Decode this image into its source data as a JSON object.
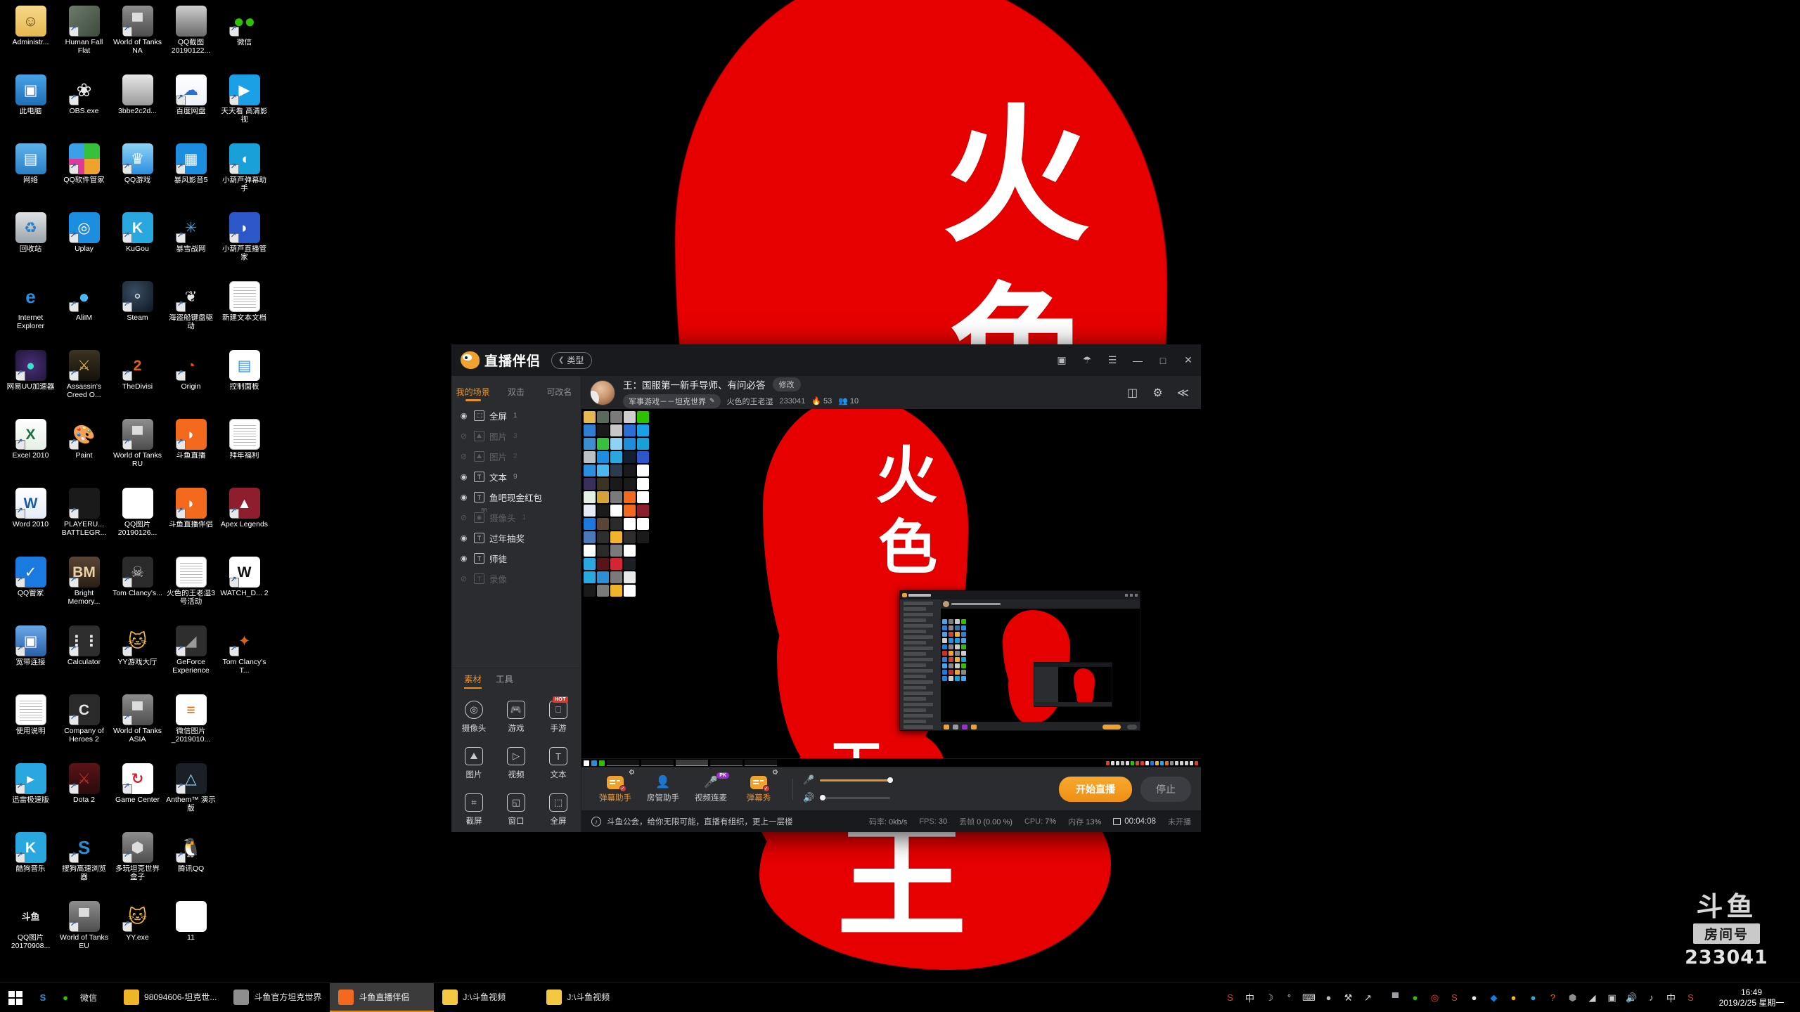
{
  "desktop": {
    "icons": [
      {
        "label": "Administr...",
        "type": "folder-user",
        "shortcut": false
      },
      {
        "label": "Human Fall Flat",
        "type": "thumb-gray",
        "shortcut": true
      },
      {
        "label": "World of Tanks NA",
        "type": "wot",
        "shortcut": true
      },
      {
        "label": "QQ截图 20190122...",
        "type": "thumb-photo",
        "shortcut": false
      },
      {
        "label": "微信",
        "type": "wechat",
        "shortcut": true
      },
      {
        "label": "此电脑",
        "type": "pc",
        "shortcut": false
      },
      {
        "label": "OBS.exe",
        "type": "obs",
        "shortcut": true
      },
      {
        "label": "3bbe2c2d...",
        "type": "thumb-shot",
        "shortcut": false
      },
      {
        "label": "百度网盘",
        "type": "baidu",
        "shortcut": true
      },
      {
        "label": "天天看 高清影视",
        "type": "tiantian",
        "shortcut": true
      },
      {
        "label": "网络",
        "type": "network",
        "shortcut": false
      },
      {
        "label": "QQ软件管家",
        "type": "qqmgr",
        "shortcut": true
      },
      {
        "label": "QQ游戏",
        "type": "qqgame",
        "shortcut": true
      },
      {
        "label": "暴风影音5",
        "type": "baofeng",
        "shortcut": true
      },
      {
        "label": "小葫芦弹幕助手",
        "type": "huluwa",
        "shortcut": true
      },
      {
        "label": "回收站",
        "type": "recycle",
        "shortcut": false
      },
      {
        "label": "Uplay",
        "type": "uplay",
        "shortcut": true
      },
      {
        "label": "KuGou",
        "type": "kugou",
        "shortcut": true
      },
      {
        "label": "暴雪战网",
        "type": "battlenet",
        "shortcut": true
      },
      {
        "label": "小葫芦直播管家",
        "type": "huluwa2",
        "shortcut": true
      },
      {
        "label": "Internet Explorer",
        "type": "ie",
        "shortcut": false
      },
      {
        "label": "AliIM",
        "type": "aliim",
        "shortcut": true
      },
      {
        "label": "Steam",
        "type": "steam",
        "shortcut": true
      },
      {
        "label": "海盗船键盘驱动",
        "type": "corsair",
        "shortcut": true
      },
      {
        "label": "新建文本文档",
        "type": "doc",
        "shortcut": false
      },
      {
        "label": "网易UU加速器",
        "type": "uu",
        "shortcut": true
      },
      {
        "label": "Assassin's Creed O...",
        "type": "acod",
        "shortcut": true
      },
      {
        "label": "TheDivisi",
        "type": "division2",
        "shortcut": true
      },
      {
        "label": "Origin",
        "type": "origin",
        "shortcut": true
      },
      {
        "label": "控制面板",
        "type": "ctrlpanel",
        "shortcut": false
      },
      {
        "label": "Excel 2010",
        "type": "excel",
        "shortcut": true
      },
      {
        "label": "Paint",
        "type": "paint",
        "shortcut": true
      },
      {
        "label": "World of Tanks RU",
        "type": "wot",
        "shortcut": true
      },
      {
        "label": "斗鱼直播",
        "type": "douyu",
        "shortcut": true
      },
      {
        "label": "拜年福利",
        "type": "doc",
        "shortcut": false
      },
      {
        "label": "Word 2010",
        "type": "word",
        "shortcut": true
      },
      {
        "label": "PLAYERU... BATTLEGR...",
        "type": "pubg",
        "shortcut": true
      },
      {
        "label": "QQ图片 20190126...",
        "type": "thumb-white",
        "shortcut": false
      },
      {
        "label": "斗鱼直播伴侣",
        "type": "douyu2",
        "shortcut": true
      },
      {
        "label": "Apex Legends",
        "type": "apex",
        "shortcut": true
      },
      {
        "label": "QQ管家",
        "type": "qqguard",
        "shortcut": true
      },
      {
        "label": "Bright Memory...",
        "type": "brightmem",
        "shortcut": true
      },
      {
        "label": "Tom Clancy's...",
        "type": "ghost",
        "shortcut": true
      },
      {
        "label": "火色的王老湿3号活动",
        "type": "doc",
        "shortcut": false
      },
      {
        "label": "WATCH_D... 2",
        "type": "watchdogs",
        "shortcut": true
      },
      {
        "label": "宽带连接",
        "type": "broadband",
        "shortcut": true
      },
      {
        "label": "Calculator",
        "type": "calc",
        "shortcut": true
      },
      {
        "label": "YY游戏大厅",
        "type": "yy",
        "shortcut": true
      },
      {
        "label": "GeForce Experience",
        "type": "geforce",
        "shortcut": true
      },
      {
        "label": "Tom Clancy's T...",
        "type": "division",
        "shortcut": true
      },
      {
        "label": "使用说明",
        "type": "doc",
        "shortcut": false
      },
      {
        "label": "Company of Heroes 2",
        "type": "coh2",
        "shortcut": true
      },
      {
        "label": "World of Tanks ASIA",
        "type": "wot",
        "shortcut": true
      },
      {
        "label": "微信图片 _2019010...",
        "type": "thumb-list",
        "shortcut": false
      },
      {
        "label": "",
        "type": "none",
        "shortcut": false
      },
      {
        "label": "迅雷极速版",
        "type": "xunlei",
        "shortcut": true
      },
      {
        "label": "Dota 2",
        "type": "dota",
        "shortcut": true
      },
      {
        "label": "Game Center",
        "type": "gamecenter",
        "shortcut": true
      },
      {
        "label": "Anthem™ 演示版",
        "type": "anthem",
        "shortcut": true
      },
      {
        "label": "",
        "type": "none",
        "shortcut": false
      },
      {
        "label": "酷狗音乐",
        "type": "kugou",
        "shortcut": true
      },
      {
        "label": "搜狗高速浏览器",
        "type": "sogou",
        "shortcut": true
      },
      {
        "label": "多玩坦克世界盒子",
        "type": "duowan",
        "shortcut": true
      },
      {
        "label": "腾讯QQ",
        "type": "qq",
        "shortcut": true
      },
      {
        "label": "",
        "type": "none",
        "shortcut": false
      },
      {
        "label": "QQ图片 20170908...",
        "type": "douyu-logo",
        "shortcut": false
      },
      {
        "label": "World of Tanks EU",
        "type": "wot",
        "shortcut": true
      },
      {
        "label": "YY.exe",
        "type": "yy",
        "shortcut": true
      },
      {
        "label": "11",
        "type": "thumb-white",
        "shortcut": false
      },
      {
        "label": "",
        "type": "none",
        "shortcut": false
      }
    ],
    "watermark": {
      "logo": "斗鱼",
      "room_label": "房间号",
      "room_number": "233041"
    },
    "wallpaper_chars": [
      "火",
      "色",
      "王"
    ]
  },
  "taskbar": {
    "start_icon": "windows-logo",
    "quick_launch": [
      {
        "name": "sogou-browser-icon",
        "glyph": "S",
        "color": "#2c8fd6"
      },
      {
        "name": "wechat-icon",
        "glyph": "●",
        "color": "#2dc100"
      }
    ],
    "quick_label": "微信",
    "items": [
      {
        "label": "98094606-坦克世...",
        "icon": "yy-icon",
        "color": "#f0b429",
        "active": false
      },
      {
        "label": "斗鱼官方坦克世界",
        "icon": "wot-icon",
        "color": "#8e8e8e",
        "active": false
      },
      {
        "label": "斗鱼直播伴侣",
        "icon": "douyu-icon",
        "color": "#f36a1e",
        "active": true
      },
      {
        "label": "J:\\斗鱼视频",
        "icon": "folder-icon",
        "color": "#f5c842",
        "active": false
      },
      {
        "label": "J:\\斗鱼视频",
        "icon": "folder-icon",
        "color": "#f5c842",
        "active": false
      }
    ],
    "tray_left": [
      {
        "name": "sogou-ime-icon",
        "glyph": "S",
        "color": "#e23b2e"
      },
      {
        "name": "ime-chinese-icon",
        "glyph": "中",
        "color": "#dcdcdc"
      },
      {
        "name": "moon-icon",
        "glyph": "☽",
        "color": "#dcdcdc"
      },
      {
        "name": "degree-icon",
        "glyph": "°",
        "color": "#dcdcdc"
      },
      {
        "name": "keyboard-icon",
        "glyph": "⌨",
        "color": "#dcdcdc"
      },
      {
        "name": "user-icon",
        "glyph": "●",
        "color": "#bbb"
      },
      {
        "name": "wrench-icon",
        "glyph": "⚒",
        "color": "#dcdcdc"
      },
      {
        "name": "expand-icon",
        "glyph": "↗",
        "color": "#dcdcdc"
      }
    ],
    "tray_right": [
      {
        "name": "wot-tray-icon",
        "glyph": "▀",
        "color": "#9aa0a6"
      },
      {
        "name": "wechat-tray-icon",
        "glyph": "●",
        "color": "#2dc100"
      },
      {
        "name": "uu-tray-icon",
        "glyph": "◎",
        "color": "#d94a3a"
      },
      {
        "name": "sogou-tray-icon",
        "glyph": "S",
        "color": "#e23b2e"
      },
      {
        "name": "qq-tray-icon",
        "glyph": "●",
        "color": "#e8e8e8"
      },
      {
        "name": "qqguard-tray-icon",
        "glyph": "◆",
        "color": "#1b7ae0"
      },
      {
        "name": "yy-tray-icon",
        "glyph": "●",
        "color": "#f0b429"
      },
      {
        "name": "baofeng-tray-icon",
        "glyph": "●",
        "color": "#29a8e0"
      },
      {
        "name": "douyu-tray-icon",
        "glyph": "?",
        "color": "#f36a1e"
      },
      {
        "name": "wot-box-tray-icon",
        "glyph": "⬢",
        "color": "#8e8e8e"
      },
      {
        "name": "network-tray-icon",
        "glyph": "◢",
        "color": "#cfcfcf"
      },
      {
        "name": "display-tray-icon",
        "glyph": "▣",
        "color": "#cfcfcf"
      },
      {
        "name": "volume-tray-icon",
        "glyph": "🔊",
        "color": "#cfcfcf"
      },
      {
        "name": "action-tray-icon",
        "glyph": "♪",
        "color": "#cfcfcf"
      },
      {
        "name": "ime-mode-icon",
        "glyph": "中",
        "color": "#dcdcdc"
      },
      {
        "name": "sogou-pinyin-icon",
        "glyph": "S",
        "color": "#e23b2e"
      }
    ],
    "clock_time": "16:49",
    "clock_date": "2019/2/25 星期一"
  },
  "app": {
    "title": "直播伴侣",
    "category_button": "类型",
    "window_controls": [
      {
        "name": "monitor-icon",
        "glyph": "▣"
      },
      {
        "name": "shirt-icon",
        "glyph": "☂"
      },
      {
        "name": "menu-icon",
        "glyph": "☰"
      },
      {
        "name": "minimize-icon",
        "glyph": "—"
      },
      {
        "name": "maximize-icon",
        "glyph": "□"
      },
      {
        "name": "close-icon",
        "glyph": "✕"
      }
    ],
    "scene_tabs": [
      {
        "label": "我的场景",
        "active": true
      },
      {
        "label": "双击",
        "active": false
      },
      {
        "label": "可改名",
        "active": false
      }
    ],
    "scenes": [
      {
        "icon": "fullscreen-icon",
        "glyph": "⬚",
        "name": "全屏",
        "num": "1",
        "visible": true
      },
      {
        "icon": "image-icon",
        "glyph": "⛰",
        "name": "图片",
        "num": "3",
        "visible": false
      },
      {
        "icon": "image-icon",
        "glyph": "⛰",
        "name": "图片",
        "num": "2",
        "visible": false
      },
      {
        "icon": "text-icon",
        "glyph": "T",
        "name": "文本",
        "num": "9",
        "visible": true
      },
      {
        "icon": "text-icon",
        "glyph": "T",
        "name": "鱼吧现金红包",
        "num": "",
        "visible": true
      },
      {
        "icon": "camera-icon",
        "glyph": "◉",
        "name": "摄像头",
        "num": "1",
        "visible": false
      },
      {
        "icon": "text-icon",
        "glyph": "T",
        "name": "过年抽奖",
        "num": "",
        "visible": true
      },
      {
        "icon": "text-icon",
        "glyph": "T",
        "name": "师徒",
        "num": "",
        "visible": true
      },
      {
        "icon": "text-icon",
        "glyph": "T",
        "name": "录像",
        "num": "",
        "visible": false
      }
    ],
    "source_tabs": [
      {
        "label": "素材",
        "active": true
      },
      {
        "label": "工具",
        "active": false
      }
    ],
    "sources": [
      {
        "label": "摄像头",
        "icon": "camera-icon",
        "glyph": "◎",
        "round": true,
        "badge": ""
      },
      {
        "label": "游戏",
        "icon": "gamepad-icon",
        "glyph": "🎮",
        "round": false,
        "badge": ""
      },
      {
        "label": "手游",
        "icon": "mobile-game-icon",
        "glyph": "⎕",
        "round": false,
        "badge": "HOT"
      },
      {
        "label": "图片",
        "icon": "image-icon",
        "glyph": "⛰",
        "round": false,
        "badge": ""
      },
      {
        "label": "视频",
        "icon": "video-icon",
        "glyph": "▷",
        "round": false,
        "badge": ""
      },
      {
        "label": "文本",
        "icon": "text-icon",
        "glyph": "T",
        "round": false,
        "badge": ""
      },
      {
        "label": "截屏",
        "icon": "crop-icon",
        "glyph": "⌗",
        "round": false,
        "badge": ""
      },
      {
        "label": "窗口",
        "icon": "window-icon",
        "glyph": "◱",
        "round": false,
        "badge": ""
      },
      {
        "label": "全屏",
        "icon": "fullscreen-icon",
        "glyph": "⬚",
        "round": false,
        "badge": ""
      }
    ],
    "user": {
      "stream_title": "王：国服第一新手导师、有问必答",
      "edit_button": "修改",
      "category": "军事游戏－－坦克世界",
      "nickname": "火色的王老湿",
      "room_id": "233041",
      "hot_count": "53",
      "viewer_count": "10"
    },
    "header_icons": [
      {
        "name": "layout-icon",
        "glyph": "◫"
      },
      {
        "name": "settings-gear-icon",
        "glyph": "⚙"
      },
      {
        "name": "share-icon",
        "glyph": "≪"
      }
    ],
    "controls": [
      {
        "label": "弹幕助手",
        "name": "danmaku-assistant",
        "type": "chip",
        "active": true,
        "gear": true,
        "check": true,
        "badge": ""
      },
      {
        "label": "房管助手",
        "name": "room-admin-assistant",
        "type": "person",
        "active": false,
        "gear": false,
        "check": false,
        "badge": ""
      },
      {
        "label": "视频连麦",
        "name": "video-link-mic",
        "type": "mic",
        "active": false,
        "gear": false,
        "check": false,
        "badge": "PK"
      },
      {
        "label": "弹幕秀",
        "name": "danmaku-show",
        "type": "chip",
        "active": true,
        "gear": true,
        "check": true,
        "badge": ""
      }
    ],
    "mic_volume_pct": 100,
    "speaker_volume_pct": 4,
    "go_live_button": "开始直播",
    "stop_button": "停止",
    "status": {
      "notice": "斗鱼公会，给你无限可能，直播有组织，更上一层楼",
      "bitrate_label": "码率:",
      "bitrate_value": "0kb/s",
      "fps_label": "FPS:",
      "fps_value": "30",
      "dropped_label": "丢帧",
      "dropped_value": "0 (0.00 %)",
      "cpu_label": "CPU:",
      "cpu_value": "7%",
      "mem_label": "内存",
      "mem_value": "13%",
      "timer": "00:04:08",
      "state": "未开播"
    }
  }
}
